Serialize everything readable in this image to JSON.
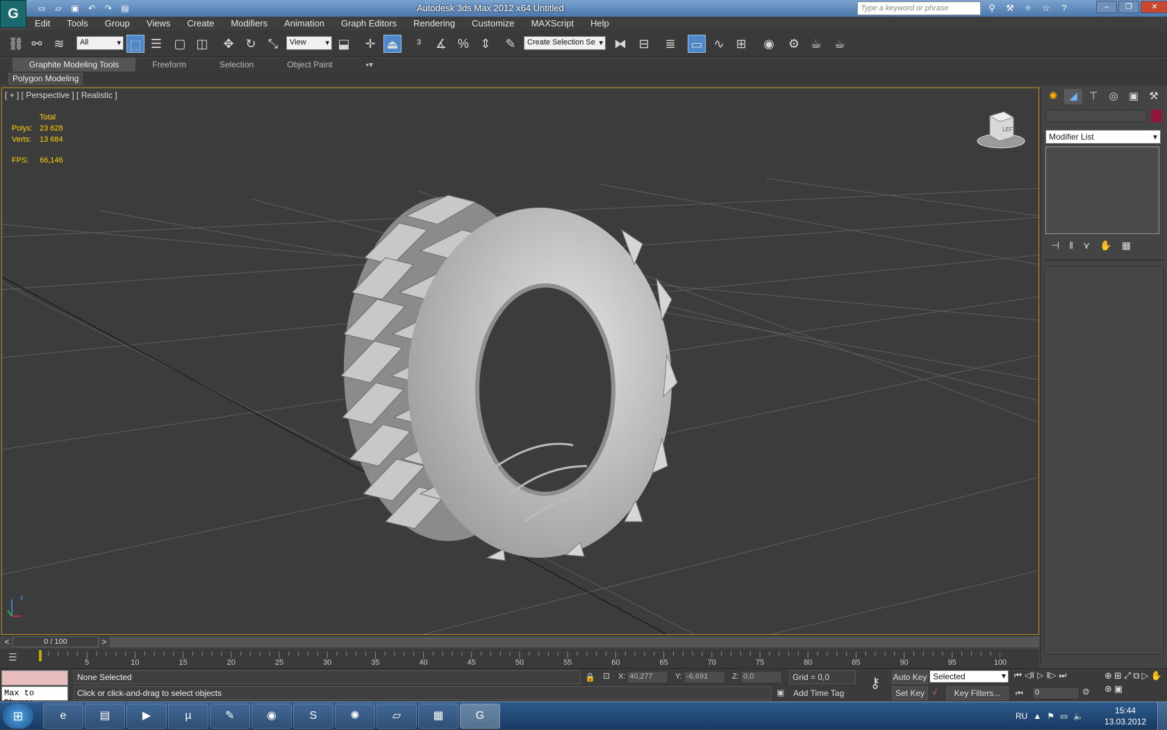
{
  "window": {
    "title": "Autodesk 3ds Max  2012 x64     Untitled",
    "search_placeholder": "Type a keyword or phrase",
    "logo_icon": "3ds-max-logo-icon"
  },
  "menu": [
    "Edit",
    "Tools",
    "Group",
    "Views",
    "Create",
    "Modifiers",
    "Animation",
    "Graph Editors",
    "Rendering",
    "Customize",
    "MAXScript",
    "Help"
  ],
  "toolbar": {
    "selection_filter": "All",
    "ref_coord": "View",
    "named_selection": "Create Selection Se"
  },
  "ribbon": {
    "tabs": [
      "Graphite Modeling Tools",
      "Freeform",
      "Selection",
      "Object Paint"
    ],
    "panel": "Polygon Modeling"
  },
  "viewport": {
    "label": "[ + ] [ Perspective ] [ Realistic ]",
    "stats": {
      "header": "Total",
      "polys_label": "Polys:",
      "polys": "23 628",
      "verts_label": "Verts:",
      "verts": "13 684",
      "fps_label": "FPS:",
      "fps": "66,146"
    },
    "viewcube_label": "LEFT",
    "axis_z": "z"
  },
  "command_panel": {
    "modifier_list": "Modifier List",
    "object_color": "#8e163b"
  },
  "timeline": {
    "slider": "0 / 100",
    "ticks": [
      "5",
      "10",
      "15",
      "20",
      "25",
      "30",
      "35",
      "40",
      "45",
      "50",
      "55",
      "60",
      "65",
      "70",
      "75",
      "80",
      "85",
      "90",
      "95",
      "100"
    ]
  },
  "status": {
    "maxscript": "Max to Physc:",
    "selection": "None Selected",
    "prompt": "Click or click-and-drag to select objects",
    "x_label": "X:",
    "x": "40,277",
    "y_label": "Y:",
    "y": "-6,691",
    "z_label": "Z:",
    "z": "0,0",
    "grid": "Grid = 0,0",
    "add_time_tag": "Add Time Tag",
    "auto_key": "Auto Key",
    "set_key": "Set Key",
    "key_mode": "Selected",
    "key_filters": "Key Filters...",
    "frame": "0"
  },
  "taskbar": {
    "lang": "RU",
    "time": "15:44",
    "date": "13.03.2012"
  }
}
